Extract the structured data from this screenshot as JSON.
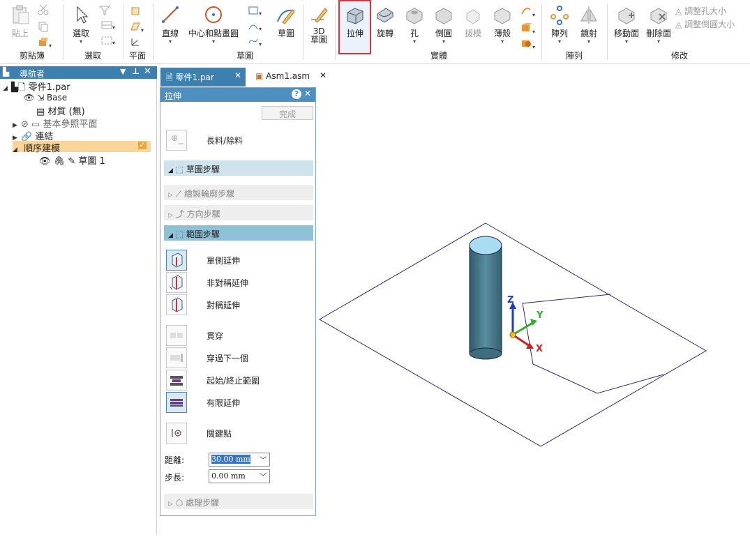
{
  "ribbon": {
    "clipboard": {
      "paste": "貼上",
      "group": "剪貼簿"
    },
    "select": {
      "select": "選取",
      "group": "選取"
    },
    "plane": {
      "group": "平面"
    },
    "sketch": {
      "line": "直線",
      "circle": "中心和點畫圓",
      "sketch": "草圖",
      "group": "草圖",
      "sketch3d_a": "3D",
      "sketch3d_b": "草圖"
    },
    "solids": {
      "extrude": "拉伸",
      "revolve": "旋轉",
      "hole": "孔",
      "round": "倒圓",
      "draft": "拔模",
      "thin": "薄殼",
      "group": "實體"
    },
    "pattern": {
      "pattern": "陣列",
      "mirror": "鏡射",
      "group": "陣列"
    },
    "modify": {
      "move_face": "移動面",
      "delete_face": "刪除面",
      "resize_hole": "調整孔大小",
      "resize_round": "調整倒圓大小",
      "group": "修改"
    }
  },
  "navigator": {
    "title": "導航者",
    "root": "零件1.par",
    "base": "Base",
    "material": "材質 (無)",
    "ref_planes": "基本參照平面",
    "links": "連結",
    "ordered": "順序建模",
    "sketch": "草圖 1"
  },
  "tabs": [
    {
      "label": "零件1.par"
    },
    {
      "label": "Asm1.asm"
    }
  ],
  "panel": {
    "title": "拉伸",
    "done": "完成",
    "add_remove": "長料/除料",
    "step_plane": "草圖步驟",
    "step_profile": "繪製輪廓步驟",
    "step_direction": "方向步驟",
    "step_extent": "範圍步驟",
    "opt_one_side": "單側延伸",
    "opt_nonsym": "非對稱延伸",
    "opt_sym": "對稱延伸",
    "opt_through_all": "貫穿",
    "opt_through_next": "穿過下一個",
    "opt_from_to": "起始/終止範圍",
    "opt_finite": "有限延伸",
    "keypoint": "關鍵點",
    "distance_label": "距離:",
    "distance_value": "30.00 mm",
    "step_label": "步長:",
    "step_value": "0.00 mm",
    "step_treatment": "處理步驟"
  },
  "viewport": {
    "axis_x": "X",
    "axis_y": "Y",
    "axis_z": "Z"
  },
  "colors": {
    "highlight": "#e0303a",
    "title_bar": "#3c7fb1",
    "step_active": "#8fc1d6",
    "axis_x": "#d02020",
    "axis_y": "#30b030",
    "axis_z": "#1c3fc0",
    "cylinder": "#4c7f92"
  }
}
